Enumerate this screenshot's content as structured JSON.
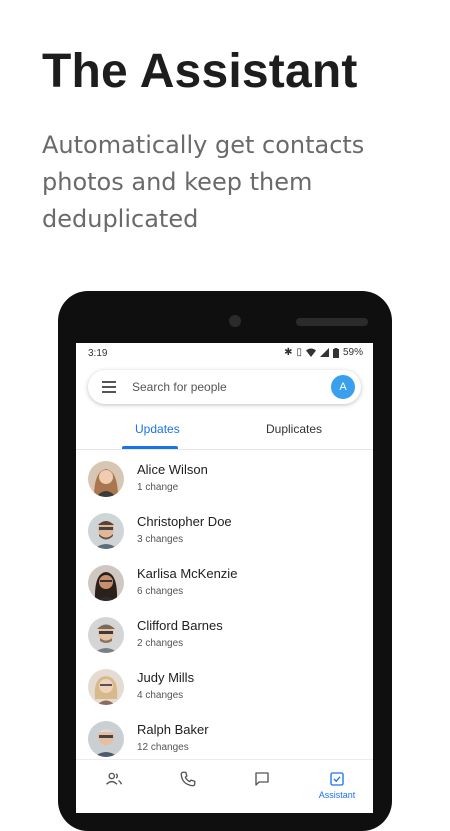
{
  "promo": {
    "title": "The Assistant",
    "subtitle": "Automatically get contacts photos and keep them deduplicated"
  },
  "status_bar": {
    "time": "3:19",
    "battery": "59%",
    "icons": [
      "bluetooth-icon",
      "vibrate-icon",
      "wifi-icon",
      "signal-icon",
      "battery-icon"
    ]
  },
  "search": {
    "placeholder": "Search for people",
    "account_initial": "A"
  },
  "tabs": [
    {
      "label": "Updates",
      "active": true
    },
    {
      "label": "Duplicates",
      "active": false
    }
  ],
  "contacts": [
    {
      "name": "Alice Wilson",
      "changes": "1 change"
    },
    {
      "name": "Christopher Doe",
      "changes": "3 changes"
    },
    {
      "name": "Karlisa McKenzie",
      "changes": "6 changes"
    },
    {
      "name": "Clifford Barnes",
      "changes": "2 changes"
    },
    {
      "name": "Judy Mills",
      "changes": "4 changes"
    },
    {
      "name": "Ralph Baker",
      "changes": "12 changes"
    }
  ],
  "bottom_nav": {
    "items": [
      {
        "icon": "contacts-icon",
        "label": ""
      },
      {
        "icon": "phone-icon",
        "label": ""
      },
      {
        "icon": "message-icon",
        "label": ""
      },
      {
        "icon": "assistant-icon",
        "label": "Assistant"
      }
    ],
    "active_index": 3
  },
  "colors": {
    "accent": "#1a73e8",
    "avatar": "#3aa0ee",
    "phone_body": "#0f0f0f"
  }
}
